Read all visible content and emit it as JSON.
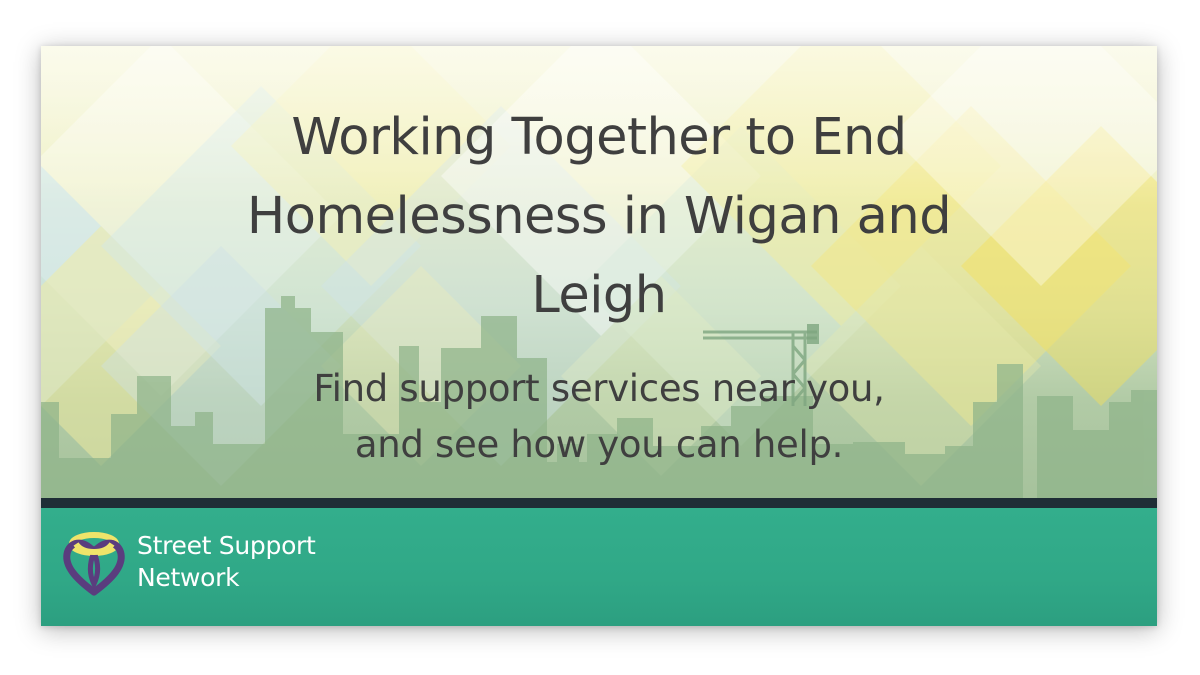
{
  "banner": {
    "headline": "Working Together to End Homelessness in Wigan and Leigh",
    "subheadline_line1": "Find support services near you,",
    "subheadline_line2": "and see how you can help."
  },
  "brand": {
    "name_line1": "Street Support",
    "name_line2": "Network",
    "logo": "heart-knot-logo"
  },
  "colors": {
    "footer": "#33ae8c",
    "divider": "#1f2e36",
    "text": "#3f3f3f",
    "skyline": "#8fb48a",
    "logo_purple": "#5a3d7e",
    "logo_yellow": "#efe46a"
  }
}
